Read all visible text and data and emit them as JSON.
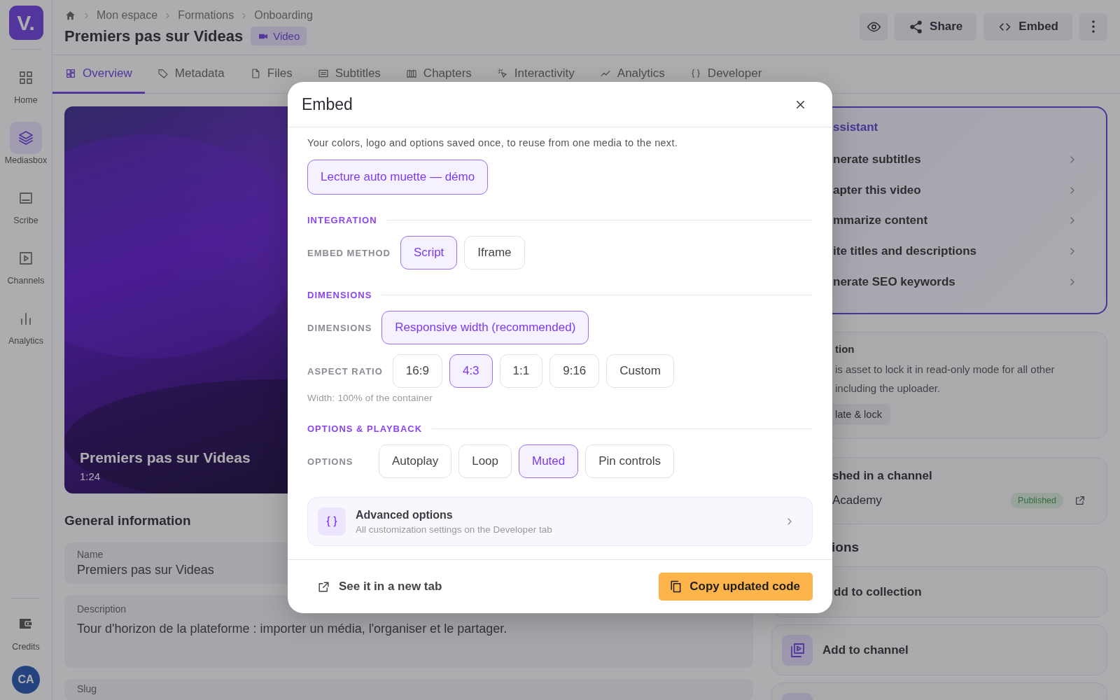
{
  "sidebar": {
    "logo": "V.",
    "items": [
      {
        "label": "Home",
        "selected": false
      },
      {
        "label": "Mediasbox",
        "selected": true
      },
      {
        "label": "Scribe",
        "selected": false
      },
      {
        "label": "Channels",
        "selected": false
      },
      {
        "label": "Analytics",
        "selected": false
      }
    ],
    "credits": "Credits",
    "avatar": "CA"
  },
  "header": {
    "breadcrumb": [
      "Mon espace",
      "Formations",
      "Onboarding"
    ],
    "title": "Premiers pas sur Videas",
    "badge": "Video",
    "buttons": [
      "Share",
      "Embed"
    ]
  },
  "tabs": [
    {
      "label": "Overview",
      "selected": true
    },
    {
      "label": "Metadata",
      "selected": false
    },
    {
      "label": "Files",
      "selected": false
    },
    {
      "label": "Subtitles",
      "selected": false
    },
    {
      "label": "Chapters",
      "selected": false
    },
    {
      "label": "Interactivity",
      "selected": false
    },
    {
      "label": "Analytics",
      "selected": false
    },
    {
      "label": "Developer",
      "selected": false
    }
  ],
  "video": {
    "title": "Premiers pas sur Videas",
    "duration": "1:24"
  },
  "general": {
    "heading": "General information",
    "fields": [
      {
        "label": "Name",
        "value": "Premiers pas sur Videas"
      },
      {
        "label": "Description",
        "value": "Tour d'horizon de la plateforme : importer un média, l'organiser et le partager."
      },
      {
        "label": "Slug"
      }
    ]
  },
  "assistant": {
    "title": "ssistant",
    "items": [
      "nerate subtitles",
      "apter this video",
      "mmarize content",
      "ite titles and descriptions",
      "nerate SEO keywords"
    ]
  },
  "validation": {
    "title": "tion",
    "lines": [
      "is asset to lock it in read-only mode for all other",
      "including the uploader."
    ],
    "button": "late & lock"
  },
  "channel": {
    "title": "shed in a channel",
    "name": "Academy",
    "status": "Published"
  },
  "actions": {
    "heading": "ions",
    "items": [
      "dd to collection",
      "Add to channel"
    ]
  },
  "modal": {
    "title": "Embed",
    "intro": "Your colors, logo and options saved once, to reuse from one media to the next.",
    "presets": [
      {
        "label": "Lecture auto muette — démo",
        "selected": true
      }
    ],
    "sections": [
      {
        "title": "INTEGRATION",
        "rows": [
          {
            "label": "EMBED METHOD",
            "options": [
              {
                "label": "Script",
                "selected": true
              },
              {
                "label": "Iframe",
                "selected": false
              }
            ]
          }
        ]
      },
      {
        "title": "DIMENSIONS",
        "rows": [
          {
            "label": "DIMENSIONS",
            "options": [
              {
                "label": "Responsive width (recommended)",
                "selected": true
              }
            ]
          },
          {
            "label": "ASPECT RATIO",
            "options": [
              {
                "label": "16:9",
                "selected": false
              },
              {
                "label": "4:3",
                "selected": true
              },
              {
                "label": "1:1",
                "selected": false
              },
              {
                "label": "9:16",
                "selected": false
              },
              {
                "label": "Custom",
                "selected": false
              }
            ],
            "hint": "Width: 100% of the container"
          }
        ]
      },
      {
        "title": "OPTIONS & PLAYBACK",
        "rows": [
          {
            "label": "OPTIONS",
            "options": [
              {
                "label": "Autoplay",
                "selected": false
              },
              {
                "label": "Loop",
                "selected": false
              },
              {
                "label": "Muted",
                "selected": true
              },
              {
                "label": "Pin controls",
                "selected": false
              }
            ]
          }
        ]
      }
    ],
    "advanced": {
      "title": "Advanced options",
      "subtitle": "All customization settings on the Developer tab"
    },
    "link": "See it in a new tab",
    "primary": "Copy updated code"
  }
}
